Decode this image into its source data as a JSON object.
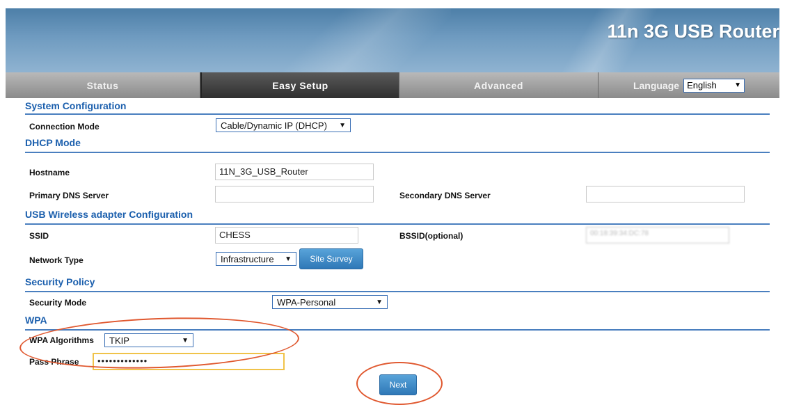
{
  "banner": {
    "title": "11n 3G USB Router"
  },
  "nav": {
    "tabs": [
      {
        "label": "Status"
      },
      {
        "label": "Easy Setup"
      },
      {
        "label": "Advanced"
      }
    ],
    "language_label": "Language",
    "language_value": "English"
  },
  "sections": {
    "system_config": "System Configuration",
    "dhcp_mode": "DHCP Mode",
    "usb_wireless": "USB Wireless adapter Configuration",
    "security_policy": "Security Policy",
    "wpa": "WPA"
  },
  "fields": {
    "connection_mode_label": "Connection Mode",
    "connection_mode_value": "Cable/Dynamic IP (DHCP)",
    "hostname_label": "Hostname",
    "hostname_value": "11N_3G_USB_Router",
    "primary_dns_label": "Primary DNS Server",
    "primary_dns_value": "",
    "secondary_dns_label": "Secondary DNS Server",
    "secondary_dns_value": "",
    "ssid_label": "SSID",
    "ssid_value": "CHESS",
    "bssid_label": "BSSID(optional)",
    "bssid_value": "00:18:39:34:DC:78",
    "network_type_label": "Network Type",
    "network_type_value": "Infrastructure",
    "site_survey_button": "Site Survey",
    "security_mode_label": "Security Mode",
    "security_mode_value": "WPA-Personal",
    "wpa_algorithms_label": "WPA Algorithms",
    "wpa_algorithms_value": "TKIP",
    "pass_phrase_label": "Pass Phrase",
    "pass_phrase_value": "•••••••••••••"
  },
  "actions": {
    "next_button": "Next"
  },
  "colors": {
    "section_text": "#1b5fad",
    "annotation_oval": "#e0582f",
    "button": "#2f78b7"
  }
}
